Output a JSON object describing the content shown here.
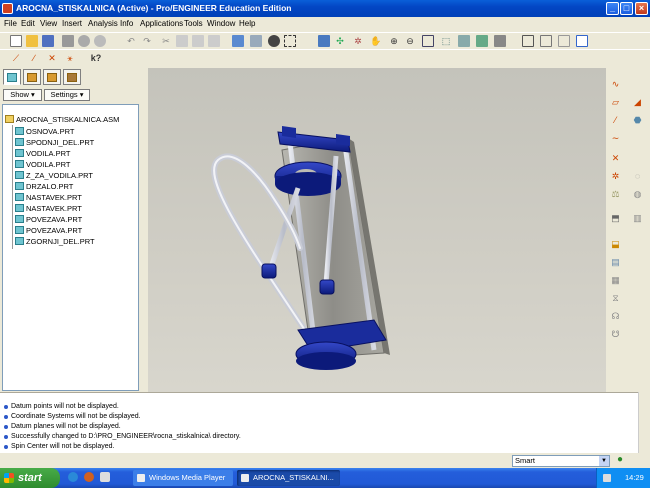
{
  "window": {
    "title": "AROCNA_STISKALNICA (Active) - Pro/ENGINEER Education Edition",
    "controls": {
      "minimize": "_",
      "maximize": "□",
      "close": "×"
    }
  },
  "menu": [
    "File",
    "Edit",
    "View",
    "Insert",
    "Analysis",
    "Info",
    "Applications",
    "Tools",
    "Window",
    "Help"
  ],
  "navigator": {
    "show_label": "Show ▾",
    "settings_label": "Settings ▾"
  },
  "model_tree": [
    {
      "name": "AROCNA_STISKALNICA.ASM",
      "type": "asm"
    },
    {
      "name": "OSNOVA.PRT",
      "type": "prt"
    },
    {
      "name": "SPODNJI_DEL.PRT",
      "type": "prt"
    },
    {
      "name": "VODILA.PRT",
      "type": "prt"
    },
    {
      "name": "VODILA.PRT",
      "type": "prt"
    },
    {
      "name": "Z_ZA_VODILA.PRT",
      "type": "prt"
    },
    {
      "name": "DRZALO.PRT",
      "type": "prt"
    },
    {
      "name": "NASTAVEK.PRT",
      "type": "prt"
    },
    {
      "name": "NASTAVEK.PRT",
      "type": "prt"
    },
    {
      "name": "POVEZAVA.PRT",
      "type": "prt"
    },
    {
      "name": "POVEZAVA.PRT",
      "type": "prt"
    },
    {
      "name": "ZGORNJI_DEL.PRT",
      "type": "prt"
    }
  ],
  "messages": [
    "Datum points will not be displayed.",
    "Coordinate Systems will not be displayed.",
    "Datum planes will not be displayed.",
    "Successfully changed to D:\\PRO_ENGINEER\\rocna_stiskalnica\\ directory.",
    "Spin Center will not be displayed."
  ],
  "status": {
    "filter_value": "Smart"
  },
  "taskbar": {
    "start_label": "start",
    "tasks": [
      "Windows Media Player",
      "AROCNA_STISKALNI..."
    ],
    "clock": "14:29"
  },
  "colors": {
    "model_blue": "#1a2c9c",
    "model_gray": "#8c8c88",
    "viewport_bg": "#cdcbc2",
    "title_blue": "#0346c4"
  }
}
